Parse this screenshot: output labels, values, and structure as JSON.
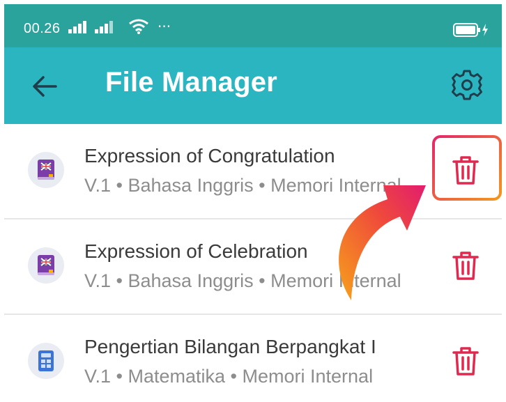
{
  "status_bar": {
    "time": "00.26",
    "more": "···"
  },
  "app_bar": {
    "title": "File Manager"
  },
  "files": [
    {
      "title": "Expression of Congratulation",
      "subtitle": "V.1 • Bahasa Inggris • Memori Internal",
      "icon": "english-book-icon"
    },
    {
      "title": "Expression of Celebration",
      "subtitle": "V.1 • Bahasa Inggris • Memori Internal",
      "icon": "english-book-icon"
    },
    {
      "title": "Pengertian Bilangan Berpangkat I",
      "subtitle": "V.1 • Matematika • Memori Internal",
      "icon": "calculator-icon"
    }
  ],
  "colors": {
    "status_bar": "#2aa39d",
    "app_bar": "#2bb5c0",
    "delete": "#e0294f",
    "highlight_start": "#e4246b",
    "highlight_end": "#f39a1d"
  }
}
